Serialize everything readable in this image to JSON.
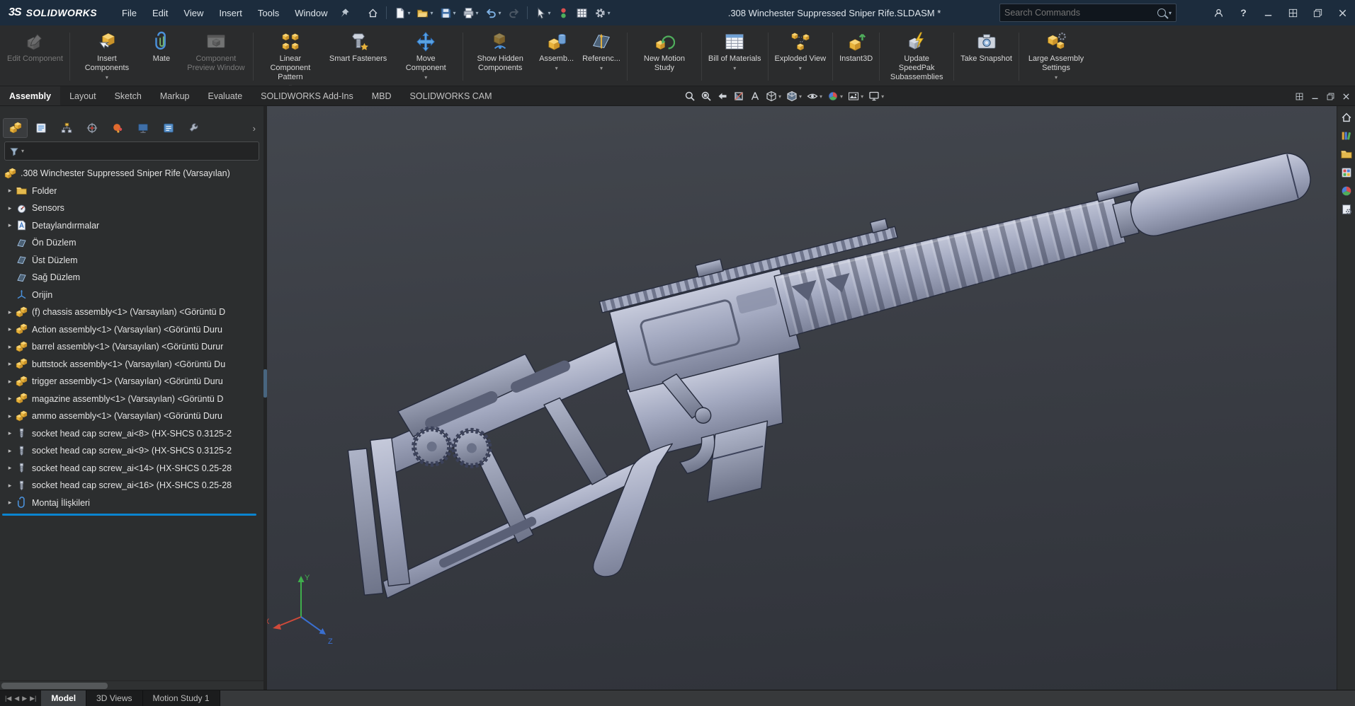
{
  "titlebar": {
    "brand_mark": "3S",
    "brand": "SOLIDWORKS",
    "menus": [
      "File",
      "Edit",
      "View",
      "Insert",
      "Tools",
      "Window"
    ],
    "document_title": ".308 Winchester Suppressed Sniper Rife.SLDASM *",
    "search": {
      "placeholder": "Search Commands",
      "value": ""
    },
    "quick_access_icons": [
      "home",
      "new-document",
      "open-document",
      "save",
      "print",
      "undo",
      "redo",
      "select-cursor",
      "rebuild",
      "design-report",
      "options-gear"
    ],
    "window_control_icons": [
      "user-account",
      "help",
      "minimize",
      "layout-panes",
      "restore",
      "close"
    ]
  },
  "ribbon": {
    "buttons": [
      {
        "label": "Edit Component",
        "disabled": true
      },
      {
        "label": "Insert Components",
        "caret": true
      },
      {
        "label": "Mate"
      },
      {
        "label": "Component Preview Window",
        "disabled": true
      },
      {
        "label": "Linear Component Pattern",
        "caret": true
      },
      {
        "label": "Smart Fasteners"
      },
      {
        "label": "Move Component",
        "caret": true
      },
      {
        "label": "Show Hidden Components"
      },
      {
        "label": "Assemb...",
        "caret": true
      },
      {
        "label": "Referenc...",
        "caret": true
      },
      {
        "label": "New Motion Study"
      },
      {
        "label": "Bill of Materials",
        "caret": true
      },
      {
        "label": "Exploded View",
        "caret": true
      },
      {
        "label": "Instant3D"
      },
      {
        "label": "Update SpeedPak Subassemblies"
      },
      {
        "label": "Take Snapshot"
      },
      {
        "label": "Large Assembly Settings",
        "caret": true
      }
    ]
  },
  "command_tabs": [
    {
      "label": "Assembly",
      "active": true
    },
    {
      "label": "Layout"
    },
    {
      "label": "Sketch"
    },
    {
      "label": "Markup"
    },
    {
      "label": "Evaluate"
    },
    {
      "label": "SOLIDWORKS Add-Ins"
    },
    {
      "label": "MBD"
    },
    {
      "label": "SOLIDWORKS CAM"
    }
  ],
  "heads_up_icons": [
    "zoom-to-fit",
    "zoom-to-area",
    "previous-view",
    "section-view",
    "annotation-view",
    "view-orientation",
    "display-style",
    "hide-show-items",
    "edit-appearance",
    "apply-scene",
    "view-settings"
  ],
  "panel_tab_icons": [
    "featuremanager-design-tree",
    "propertymanager",
    "configurationmanager",
    "dimxpertmanager",
    "displaymanager",
    "cam-feature-tree",
    "cam-operation-tree",
    "cam-tools"
  ],
  "feature_tree": {
    "filter": {
      "value": "",
      "placeholder": ""
    },
    "items": [
      {
        "label": ".308 Winchester Suppressed Sniper Rife (Varsayılan)",
        "icon": "assembly"
      },
      {
        "label": "Folder",
        "icon": "folder"
      },
      {
        "label": "Sensors",
        "icon": "sensors"
      },
      {
        "label": "Detaylandırmalar",
        "icon": "annotations"
      },
      {
        "label": "Ön Düzlem",
        "icon": "plane"
      },
      {
        "label": "Üst Düzlem",
        "icon": "plane"
      },
      {
        "label": "Sağ Düzlem",
        "icon": "plane"
      },
      {
        "label": "Orijin",
        "icon": "origin"
      },
      {
        "label": "(f) chassis assembly<1> (Varsayılan) <Görüntü D",
        "icon": "subassembly"
      },
      {
        "label": "Action assembly<1> (Varsayılan) <Görüntü Duru",
        "icon": "subassembly"
      },
      {
        "label": "barrel assembly<1> (Varsayılan) <Görüntü Durur",
        "icon": "subassembly"
      },
      {
        "label": "buttstock assembly<1> (Varsayılan) <Görüntü Du",
        "icon": "subassembly"
      },
      {
        "label": "trigger assembly<1> (Varsayılan) <Görüntü Duru",
        "icon": "subassembly"
      },
      {
        "label": "magazine assembly<1> (Varsayılan) <Görüntü D",
        "icon": "subassembly"
      },
      {
        "label": "ammo assembly<1> (Varsayılan) <Görüntü Duru",
        "icon": "subassembly"
      },
      {
        "label": "socket head cap screw_ai<8> (HX-SHCS 0.3125-2",
        "icon": "screw"
      },
      {
        "label": "socket head cap screw_ai<9> (HX-SHCS 0.3125-2",
        "icon": "screw"
      },
      {
        "label": "socket head cap screw_ai<14> (HX-SHCS 0.25-28",
        "icon": "screw"
      },
      {
        "label": "socket head cap screw_ai<16> (HX-SHCS 0.25-28",
        "icon": "screw"
      },
      {
        "label": "Montaj İlişkileri",
        "icon": "mates"
      }
    ]
  },
  "viewport": {
    "triad": {
      "x": "X",
      "y": "Y",
      "z": "Z"
    }
  },
  "task_pane_icons": [
    "solidworks-resources",
    "design-library",
    "file-explorer",
    "view-palette",
    "appearances-scenes",
    "custom-properties"
  ],
  "bottom_bar": {
    "tabs": [
      {
        "label": "Model",
        "active": true
      },
      {
        "label": "3D Views"
      },
      {
        "label": "Motion Study 1"
      }
    ]
  },
  "colors": {
    "titlebar": "#1c2c3d",
    "ribbon": "#2b2c2d",
    "panel": "#2c2e2f",
    "viewport_top": "#43474e",
    "viewport_bottom": "#30333a",
    "model_fill": "#a4aac1",
    "rollback_bar": "#0a84d0",
    "triad_x": "#d04a3a",
    "triad_y": "#3fae4c",
    "triad_z": "#3a6fd0"
  }
}
